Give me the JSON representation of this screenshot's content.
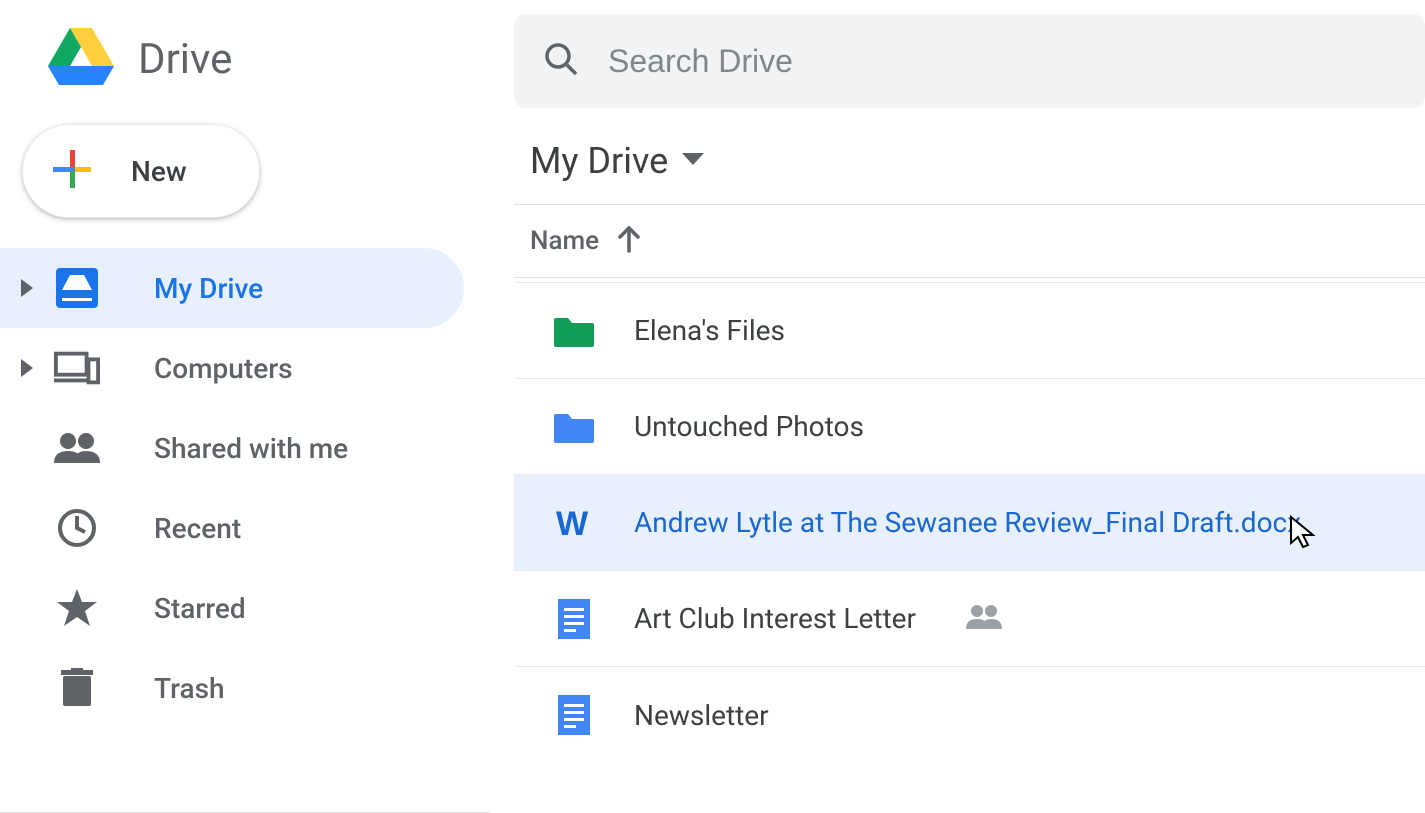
{
  "brand": {
    "name": "Drive"
  },
  "new_button": {
    "label": "New"
  },
  "sidebar": {
    "items": [
      {
        "label": "My Drive"
      },
      {
        "label": "Computers"
      },
      {
        "label": "Shared with me"
      },
      {
        "label": "Recent"
      },
      {
        "label": "Starred"
      },
      {
        "label": "Trash"
      }
    ]
  },
  "search": {
    "placeholder": "Search Drive"
  },
  "location": {
    "label": "My Drive"
  },
  "columns": {
    "name": "Name"
  },
  "files": [
    {
      "name": "Elena's Files"
    },
    {
      "name": "Untouched Photos"
    },
    {
      "name": "Andrew Lytle at The Sewanee Review_Final Draft.docx"
    },
    {
      "name": "Art Club Interest Letter"
    },
    {
      "name": "Newsletter"
    }
  ]
}
